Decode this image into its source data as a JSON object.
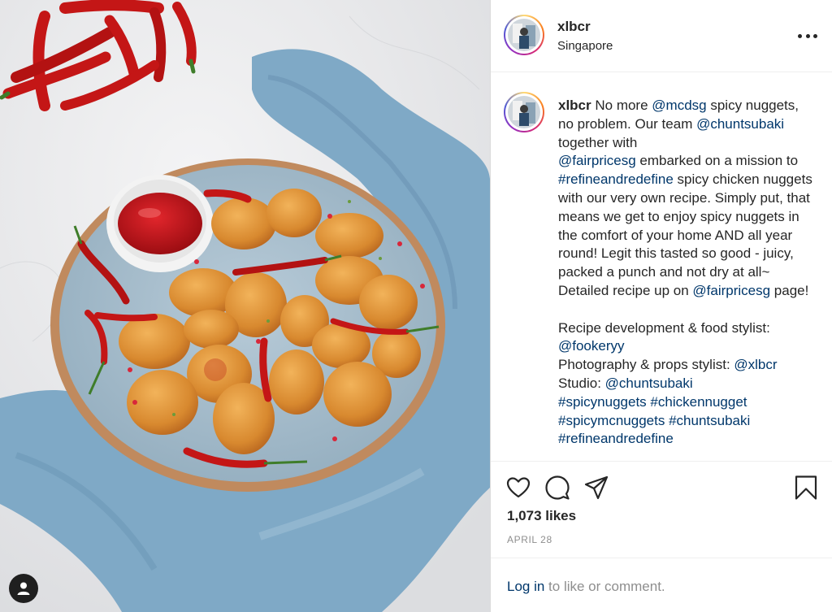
{
  "post": {
    "username": "xlbcr",
    "location": "Singapore",
    "likes": "1,073 likes",
    "date": "APRIL 28"
  },
  "caption": {
    "username": "xlbcr",
    "t1": " No more ",
    "m_mcdsg": "@mcdsg",
    "t2": " spicy nuggets, no problem. Our team ",
    "m_chuntsubaki": "@chuntsubaki",
    "t3": " together with ",
    "m_fairpricesg": "@fairpricesg",
    "t4": " embarked on a mission to ",
    "h_refine": "#refineandredefine",
    "t5": " spicy chicken nuggets with our very own recipe. Simply put, that means we get to enjoy spicy nuggets in the comfort of your home AND all year round! Legit this tasted so good - juicy, packed a punch and not dry at all~ Detailed recipe up on ",
    "m_fairpricesg2": "@fairpricesg",
    "t6": " page!",
    "t7": "Recipe development & food stylist:",
    "m_fookeryy": "@fookeryy",
    "t8": "Photography & props stylist: ",
    "m_xlbcr": "@xlbcr",
    "t9": "Studio: ",
    "m_chuntsubaki2": "@chuntsubaki",
    "h1": "#spicynuggets",
    "h2": "#chickennugget",
    "h3": "#spicymcnuggets",
    "h4": "#chuntsubaki",
    "h5": "#refineandredefine"
  },
  "footer": {
    "login_link": "Log in",
    "login_rest": " to like or comment."
  },
  "icons": {
    "more": "more-options-icon",
    "like": "heart-icon",
    "comment": "comment-icon",
    "share": "share-icon",
    "save": "bookmark-icon",
    "user_tags": "user-tag-icon"
  },
  "colors": {
    "link": "#00376b",
    "text": "#262626",
    "muted": "#8e8e8e",
    "divider": "#efefef"
  }
}
